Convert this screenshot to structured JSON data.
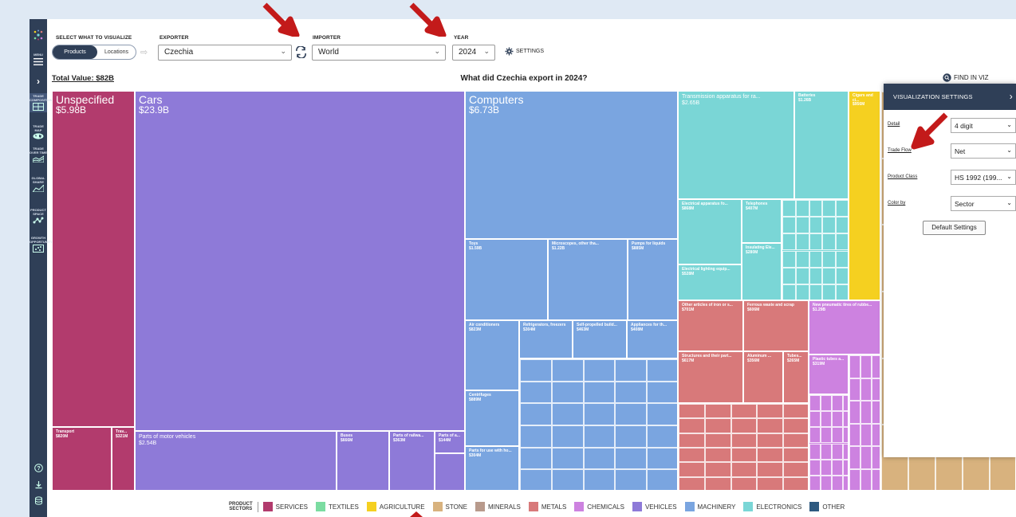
{
  "sidebar": {
    "menu_label": "MENU",
    "items": [
      {
        "label": "TRADE COMPOSITION",
        "icon": "treemap-icon"
      },
      {
        "label": "TRADE MAP",
        "icon": "world-map-icon"
      },
      {
        "label": "TRADE OVER TIME",
        "icon": "stacked-area-icon"
      },
      {
        "label": "GLOBAL SHARE",
        "icon": "area-chart-icon"
      },
      {
        "label": "PRODUCT SPACE",
        "icon": "network-icon"
      },
      {
        "label": "GROWTH OPPORTUNITY",
        "icon": "scatter-grid-icon"
      }
    ],
    "bottom_icons": [
      "help-icon",
      "download-icon",
      "database-icon"
    ]
  },
  "header": {
    "select_label": "SELECT WHAT TO VISUALIZE",
    "toggle": {
      "products": "Products",
      "locations": "Locations"
    },
    "exporter_label": "EXPORTER",
    "exporter_value": "Czechia",
    "importer_label": "IMPORTER",
    "importer_value": "World",
    "year_label": "YEAR",
    "year_value": "2024",
    "settings_label": "SETTINGS"
  },
  "viz": {
    "total": "Total Value: $82B",
    "title": "What did Czechia export in 2024?",
    "find": "FIND IN VIZ"
  },
  "chart_data": {
    "type": "treemap",
    "title": "What did Czechia export in 2024?",
    "items": [
      {
        "name": "Unspecified",
        "value": "$5.98B",
        "sector": "SERVICES"
      },
      {
        "name": "Transport",
        "value": "$820M",
        "sector": "SERVICES"
      },
      {
        "name": "Trav...",
        "value": "$321M",
        "sector": "SERVICES"
      },
      {
        "name": "Cars",
        "value": "$23.9B",
        "sector": "VEHICLES"
      },
      {
        "name": "Parts of motor vehicles",
        "value": "$2.54B",
        "sector": "VEHICLES"
      },
      {
        "name": "Buses",
        "value": "$666M",
        "sector": "VEHICLES"
      },
      {
        "name": "Parts of railwa...",
        "value": "$363M",
        "sector": "VEHICLES"
      },
      {
        "name": "Parts of a...",
        "value": "$144M",
        "sector": "VEHICLES"
      },
      {
        "name": "Computers",
        "value": "$6.73B",
        "sector": "MACHINERY"
      },
      {
        "name": "Toys",
        "value": "$1.59B",
        "sector": "MACHINERY"
      },
      {
        "name": "Microscopes, other tha...",
        "value": "$1.22B",
        "sector": "MACHINERY"
      },
      {
        "name": "Pumps for liquids",
        "value": "$885M",
        "sector": "MACHINERY"
      },
      {
        "name": "Air conditioners",
        "value": "$823M",
        "sector": "MACHINERY"
      },
      {
        "name": "Refrigerators, freezers",
        "value": "$304M",
        "sector": "MACHINERY"
      },
      {
        "name": "Self-propelled build...",
        "value": "$463M",
        "sector": "MACHINERY"
      },
      {
        "name": "Appliances for th...",
        "value": "$408M",
        "sector": "MACHINERY"
      },
      {
        "name": "Centrifuges",
        "value": "$889M",
        "sector": "MACHINERY"
      },
      {
        "name": "Parts for use with ho...",
        "value": "$304M",
        "sector": "MACHINERY"
      },
      {
        "name": "Transmission apparatus for ra...",
        "value": "$2.65B",
        "sector": "ELECTRONICS"
      },
      {
        "name": "Batteries",
        "value": "$1.26B",
        "sector": "ELECTRONICS"
      },
      {
        "name": "Electrical apparatus fo...",
        "value": "$868M",
        "sector": "ELECTRONICS"
      },
      {
        "name": "Telephones",
        "value": "$407M",
        "sector": "ELECTRONICS"
      },
      {
        "name": "Electrical lighting equip...",
        "value": "$528M",
        "sector": "ELECTRONICS"
      },
      {
        "name": "Insulating Ele...",
        "value": "$280M",
        "sector": "ELECTRONICS"
      },
      {
        "name": "Cigars and ci...",
        "value": "$956M",
        "sector": "AGRICULTURE"
      },
      {
        "name": "Other articles of iron or s...",
        "value": "$701M",
        "sector": "METALS"
      },
      {
        "name": "Ferrous waste and scrap",
        "value": "$606M",
        "sector": "METALS"
      },
      {
        "name": "Structures and their part...",
        "value": "$617M",
        "sector": "METALS"
      },
      {
        "name": "Aluminum ...",
        "value": "$356M",
        "sector": "METALS"
      },
      {
        "name": "Tubes...",
        "value": "$265M",
        "sector": "METALS"
      },
      {
        "name": "New pneumatic tires of rubbe...",
        "value": "$1.29B",
        "sector": "CHEMICALS"
      },
      {
        "name": "Plastic tubes a...",
        "value": "$319M",
        "sector": "CHEMICALS"
      }
    ]
  },
  "legend": {
    "title_line1": "PRODUCT",
    "title_line2": "SECTORS",
    "items": [
      {
        "label": "SERVICES",
        "color": "#b23b6d"
      },
      {
        "label": "TEXTILES",
        "color": "#7bdca1"
      },
      {
        "label": "AGRICULTURE",
        "color": "#f5d020"
      },
      {
        "label": "STONE",
        "color": "#d8b27e"
      },
      {
        "label": "MINERALS",
        "color": "#b89a8c"
      },
      {
        "label": "METALS",
        "color": "#d8797a"
      },
      {
        "label": "CHEMICALS",
        "color": "#cd82e0"
      },
      {
        "label": "VEHICLES",
        "color": "#8e7ad8"
      },
      {
        "label": "MACHINERY",
        "color": "#7aa5e0"
      },
      {
        "label": "ELECTRONICS",
        "color": "#7ad6d6"
      },
      {
        "label": "OTHER",
        "color": "#2e5a80"
      }
    ]
  },
  "panel": {
    "title": "VISUALIZATION SETTINGS",
    "rows": [
      {
        "label": "Detail",
        "value": "4 digit"
      },
      {
        "label": "Trade Flow",
        "value": "Net"
      },
      {
        "label": "Product Class",
        "value": "HS 1992 (199..."
      },
      {
        "label": "Color by",
        "value": "Sector"
      }
    ],
    "default_button": "Default Settings"
  }
}
